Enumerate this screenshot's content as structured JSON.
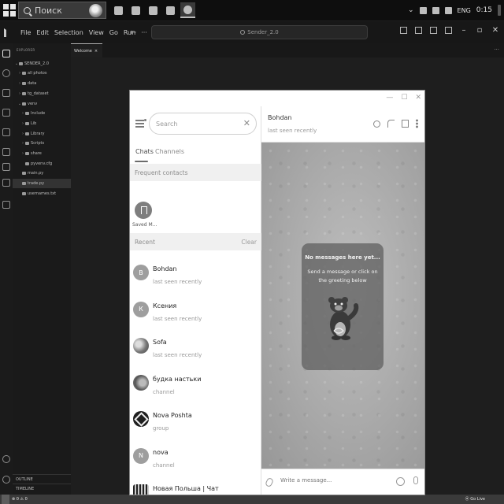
{
  "taskbar": {
    "search_placeholder": "Поиск",
    "apps": [
      "file-explorer-icon",
      "store-icon",
      "vscode-icon",
      "app-icon",
      "telegram-icon"
    ],
    "tray": {
      "lang": "ENG",
      "time": "0:15"
    }
  },
  "vscode": {
    "menu": [
      "File",
      "Edit",
      "Selection",
      "View",
      "Go",
      "Run",
      "···"
    ],
    "command_center": "Sender_2.0",
    "explorer_title": "EXPLORER",
    "tree": [
      {
        "label": "SENDER_2.0",
        "chev": "⌄",
        "indent": 0
      },
      {
        "label": "all photos",
        "chev": "›",
        "indent": 1
      },
      {
        "label": "data",
        "chev": "›",
        "indent": 1
      },
      {
        "label": "tg_dataset",
        "chev": "›",
        "indent": 1
      },
      {
        "label": "venv",
        "chev": "⌄",
        "indent": 1
      },
      {
        "label": "Include",
        "chev": "›",
        "indent": 2
      },
      {
        "label": "Lib",
        "chev": "›",
        "indent": 2
      },
      {
        "label": "Library",
        "chev": "›",
        "indent": 2
      },
      {
        "label": "Scripts",
        "chev": "›",
        "indent": 2
      },
      {
        "label": "share",
        "chev": "›",
        "indent": 2
      },
      {
        "label": "pyvenv.cfg",
        "chev": "",
        "indent": 2
      },
      {
        "label": "main.py",
        "chev": "",
        "indent": 1
      },
      {
        "label": "trade.py",
        "chev": "",
        "indent": 1
      },
      {
        "label": "usernames.txt",
        "chev": "",
        "indent": 1
      }
    ],
    "outline": "OUTLINE",
    "timeline": "TIMELINE",
    "tab_label": "Welcome",
    "tab_close": "×",
    "tab_more": "···",
    "status_left": "⊗ 0 ⚠ 0",
    "status_golive": "⦿ Go Live"
  },
  "telegram": {
    "window_buttons": [
      "—",
      "☐",
      "✕"
    ],
    "search_placeholder": "Search",
    "search_clear": "✕",
    "tabs": [
      "Chats",
      "Channels"
    ],
    "frequent_contacts": "Frequent contacts",
    "saved_label": "Saved M...",
    "recent": "Recent",
    "clear": "Clear",
    "chats": [
      {
        "name": "Bohdan",
        "sub": "last seen recently",
        "initial": "B",
        "avatar": "letter"
      },
      {
        "name": "Ксения",
        "sub": "last seen recently",
        "initial": "К",
        "avatar": "letter"
      },
      {
        "name": "Sofa",
        "sub": "last seen recently",
        "initial": "",
        "avatar": "img1"
      },
      {
        "name": "будка настьки",
        "sub": "channel",
        "initial": "",
        "avatar": "img2"
      },
      {
        "name": "Nova Poshta",
        "sub": "group",
        "initial": "",
        "avatar": "np"
      },
      {
        "name": "nova",
        "sub": "channel",
        "initial": "N",
        "avatar": "letter"
      },
      {
        "name": "Новая Польша | Чат",
        "sub": "",
        "initial": "",
        "avatar": "pl"
      }
    ],
    "peer": {
      "name": "Bohdan",
      "status": "last seen recently"
    },
    "empty": {
      "title": "No messages here yet...",
      "desc": "Send a message or click on the greeting below"
    },
    "composer_placeholder": "Write a message..."
  }
}
